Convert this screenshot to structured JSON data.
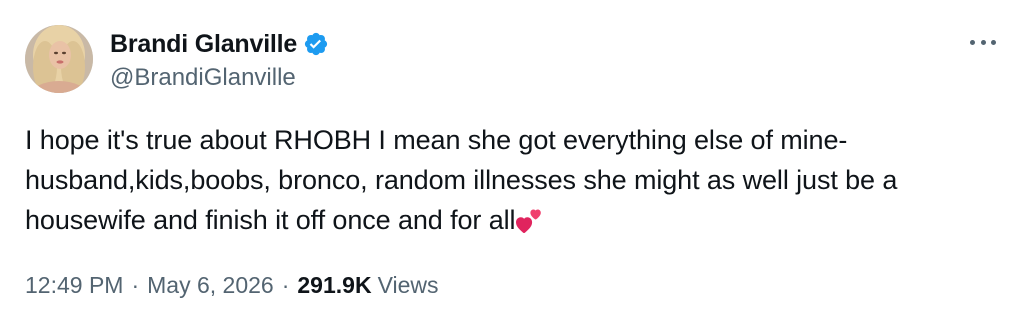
{
  "author": {
    "display_name": "Brandi Glanville",
    "handle": "@BrandiGlanville",
    "verified": true,
    "verified_color": "#1d9bf0",
    "avatar_icon": "profile-photo"
  },
  "tweet": {
    "text": "I hope it's true about RHOBH I mean she got everything else of mine-husband,kids,boobs, bronco, random illnesses she might as well just be a housewife and finish it off once and for all",
    "emoji": "two-hearts-icon"
  },
  "meta": {
    "time": "12:49 PM",
    "separator": "·",
    "date": "May 6, 2026",
    "views_count": "291.9K",
    "views_label": "Views"
  },
  "menu": {
    "icon": "more-horizontal-icon"
  },
  "colors": {
    "text_primary": "#0f1419",
    "text_secondary": "#536471",
    "heart": "#e0245e"
  }
}
